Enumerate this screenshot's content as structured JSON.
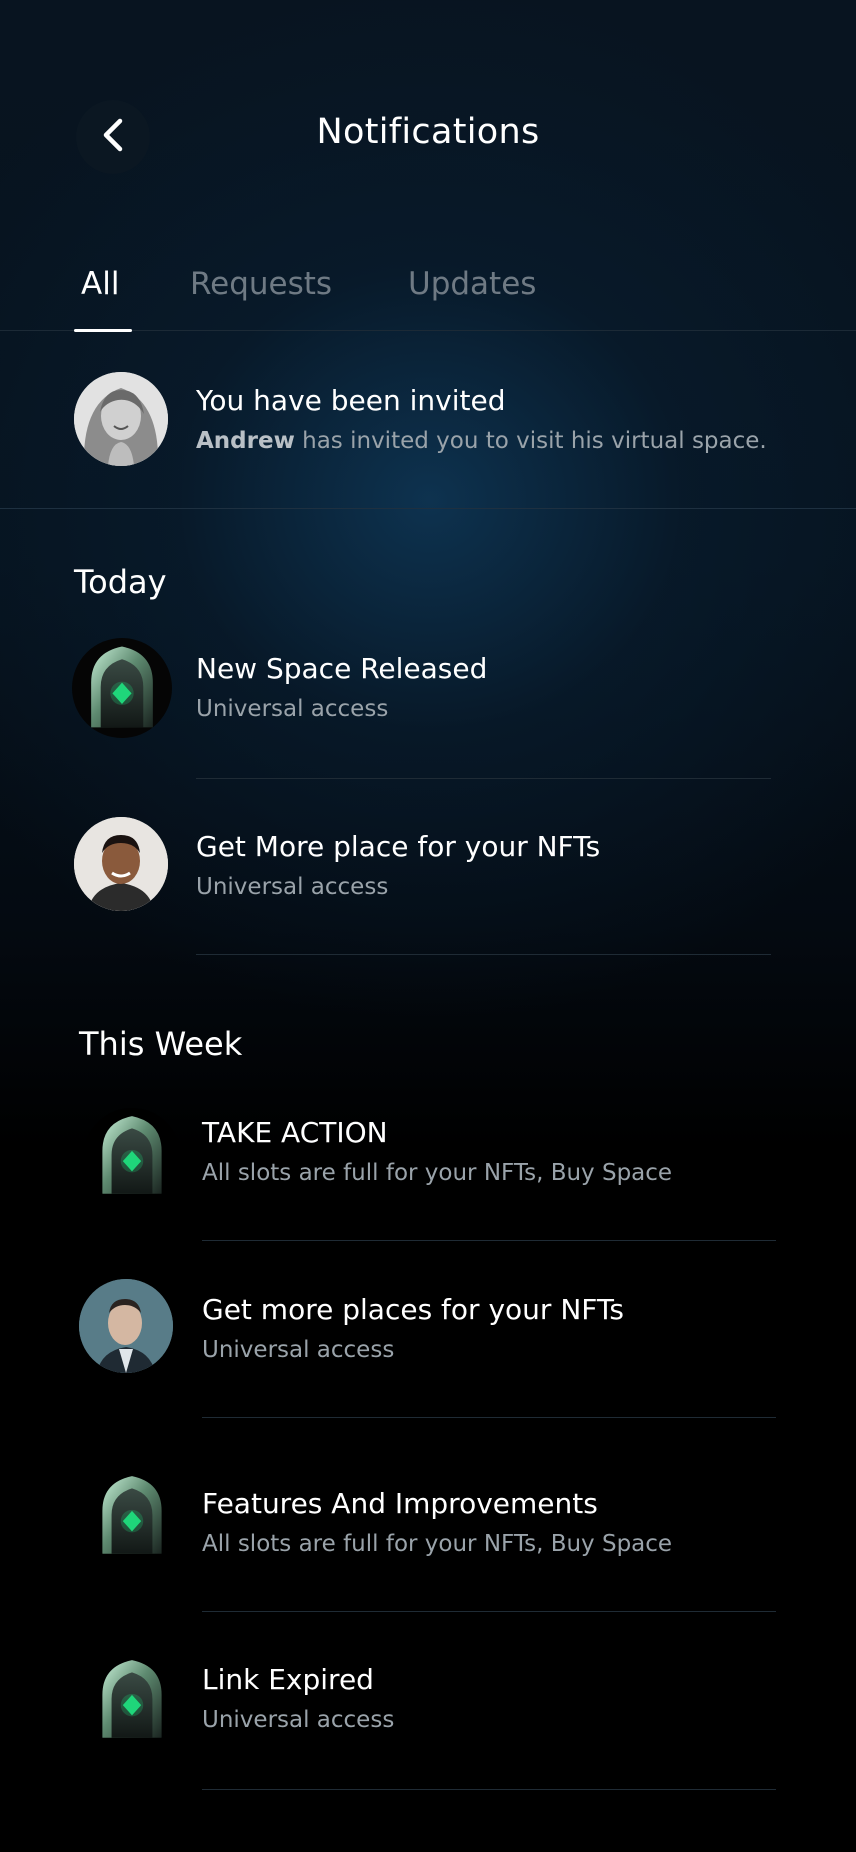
{
  "header": {
    "title": "Notifications",
    "back_icon": "chevron-left-icon"
  },
  "tabs": [
    {
      "label": "All",
      "active": true
    },
    {
      "label": "Requests",
      "active": false
    },
    {
      "label": "Updates",
      "active": false
    }
  ],
  "invite": {
    "title": "You have been invited",
    "sender": "Andrew",
    "message": " has invited you to visit his virtual space."
  },
  "today": {
    "heading": "Today",
    "items": [
      {
        "title": "New Space Released",
        "subtitle": "Universal access",
        "icon": "space-logo-icon"
      },
      {
        "title": "Get More place for your NFTs",
        "subtitle": "Universal access",
        "icon": "user-avatar"
      }
    ]
  },
  "this_week": {
    "heading": "This Week",
    "items": [
      {
        "title": "TAKE ACTION",
        "subtitle": "All slots are full for your NFTs, Buy Space",
        "icon": "space-logo-icon"
      },
      {
        "title": "Get more places for your NFTs",
        "subtitle": "Universal access",
        "icon": "user-avatar"
      },
      {
        "title": "Features And Improvements",
        "subtitle": "All slots are full for your NFTs, Buy Space",
        "icon": "space-logo-icon"
      },
      {
        "title": "Link Expired",
        "subtitle": "Universal access",
        "icon": "space-logo-icon"
      }
    ]
  },
  "colors": {
    "background": "#000000",
    "accent_green": "#1fd67a",
    "muted_text": "#9aa3aa"
  }
}
